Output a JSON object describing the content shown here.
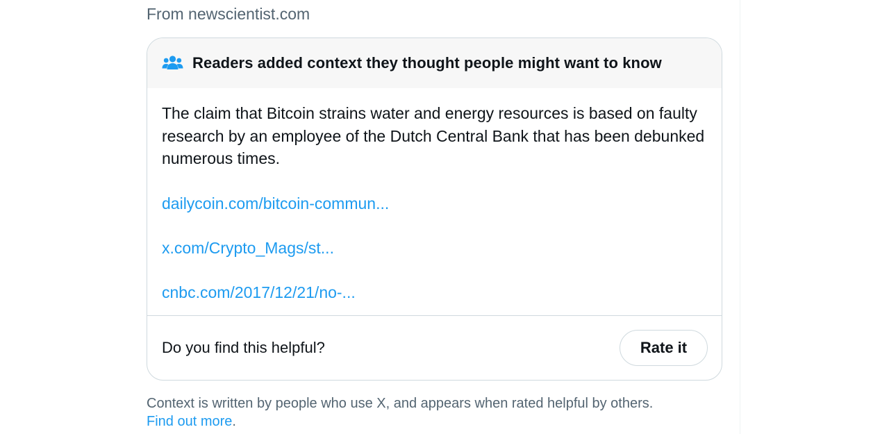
{
  "source": {
    "text": "From newscientist.com"
  },
  "note": {
    "header_title": "Readers added context they thought people might want to know",
    "header_icon": "people-group-icon",
    "body_text": "The claim that Bitcoin strains water and energy resources is based on faulty research by an employee of the Dutch Central Bank that has been debunked numerous times.",
    "links": [
      {
        "label": "dailycoin.com/bitcoin-commun..."
      },
      {
        "label": "x.com/Crypto_Mags/st..."
      },
      {
        "label": "cnbc.com/2017/12/21/no-..."
      }
    ],
    "helpful_question": "Do you find this helpful?",
    "rate_button": "Rate it"
  },
  "footnote": {
    "text": "Context is written by people who use X, and appears when rated helpful by others.",
    "link": "Find out more",
    "suffix": "."
  },
  "colors": {
    "link": "#1d9bf0",
    "secondary_text": "#536471",
    "primary_text": "#0f1419",
    "border": "#cfd9de",
    "header_bg": "#f7f7f7"
  }
}
